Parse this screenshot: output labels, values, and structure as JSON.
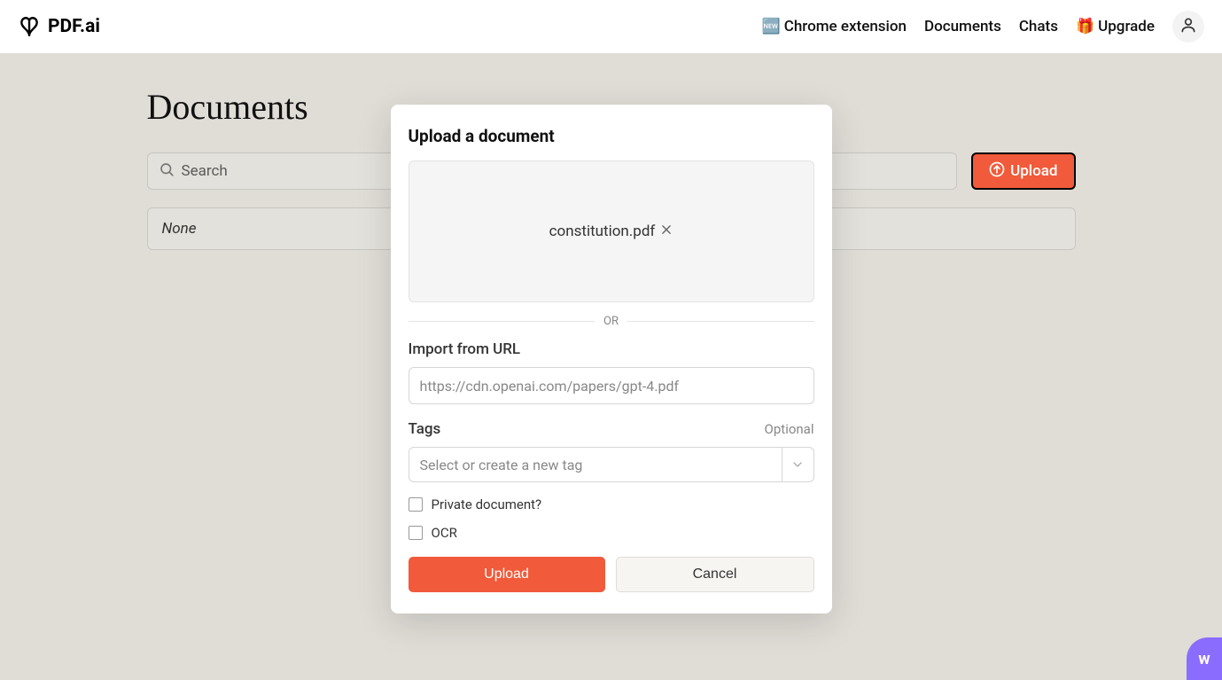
{
  "header": {
    "brand": "PDF.ai",
    "nav": {
      "chrome_ext_emoji": "🆕",
      "chrome_ext": "Chrome extension",
      "documents": "Documents",
      "chats": "Chats",
      "upgrade_emoji": "🎁",
      "upgrade": "Upgrade"
    }
  },
  "page": {
    "title": "Documents",
    "search_placeholder": "Search",
    "upload_button": "Upload",
    "empty_state": "None"
  },
  "modal": {
    "title": "Upload a document",
    "file_name": "constitution.pdf",
    "or": "OR",
    "import_label": "Import from URL",
    "url_placeholder": "https://cdn.openai.com/papers/gpt-4.pdf",
    "tags_label": "Tags",
    "optional_label": "Optional",
    "tags_placeholder": "Select or create a new tag",
    "private_label": "Private document?",
    "ocr_label": "OCR",
    "upload_btn": "Upload",
    "cancel_btn": "Cancel"
  },
  "widget": {
    "letter": "w"
  }
}
